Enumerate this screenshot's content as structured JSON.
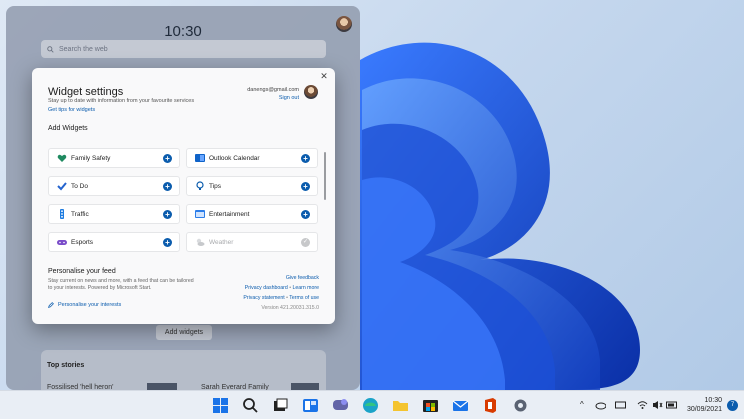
{
  "board": {
    "clock": "10:30",
    "search_placeholder": "Search the web",
    "add_widgets_label": "Add widgets",
    "top_stories_label": "Top stories",
    "story1": "Fossilised 'hell heron'",
    "story2": "Sarah Everard Family"
  },
  "dialog": {
    "title": "Widget settings",
    "subtitle": "Stay up to date with information from your favourite services",
    "tips_link": "Get tips for widgets",
    "email": "danengs@gmail.com",
    "sign_out": "Sign out",
    "add_widgets_heading": "Add Widgets",
    "widgets": [
      {
        "label": "Family Safety",
        "icon": "family-safety-icon",
        "state": "add"
      },
      {
        "label": "Outlook Calendar",
        "icon": "outlook-calendar-icon",
        "state": "add"
      },
      {
        "label": "To Do",
        "icon": "to-do-icon",
        "state": "add"
      },
      {
        "label": "Tips",
        "icon": "tips-icon",
        "state": "add"
      },
      {
        "label": "Traffic",
        "icon": "traffic-icon",
        "state": "add"
      },
      {
        "label": "Entertainment",
        "icon": "entertainment-icon",
        "state": "add"
      },
      {
        "label": "Esports",
        "icon": "esports-icon",
        "state": "add"
      },
      {
        "label": "Weather",
        "icon": "weather-icon",
        "state": "added"
      }
    ],
    "personalise": {
      "title": "Personalise your feed",
      "description": "Stay current on news and more, with a feed that can be tailored to your interests. Powered by Microsoft Start.",
      "link": "Personalise your interests"
    },
    "give_feedback": "Give feedback",
    "privacy_dashboard": "Privacy dashboard",
    "learn_more": "Learn more",
    "privacy_statement": "Privacy statement",
    "terms_of_use": "Terms of use",
    "separator": "•",
    "version": "Version 421.20031.315.0"
  },
  "taskbar": {
    "time": "10:30",
    "date": "30/09/2021",
    "notification_count": "7",
    "tray_chevron": "^"
  },
  "colors": {
    "accent": "#0b5cad",
    "wallpaper_blue": "#1a4fd8"
  }
}
